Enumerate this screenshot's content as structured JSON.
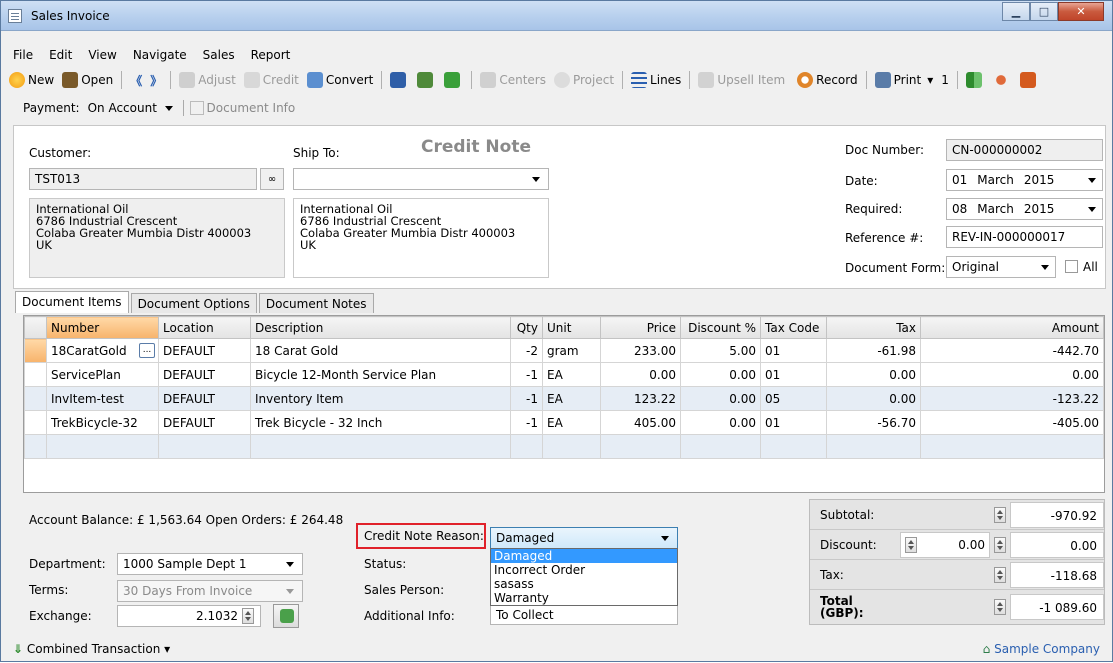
{
  "window": {
    "title": "Sales Invoice"
  },
  "menu": [
    "File",
    "Edit",
    "View",
    "Navigate",
    "Sales",
    "Report"
  ],
  "toolbar": {
    "new": "New",
    "open": "Open",
    "adjust": "Adjust",
    "credit": "Credit",
    "convert": "Convert",
    "centers": "Centers",
    "project": "Project",
    "lines": "Lines",
    "upsell": "Upsell Item",
    "record": "Record",
    "print": "Print",
    "copies": "1"
  },
  "payment": {
    "label": "Payment:",
    "value": "On Account",
    "docinfo": "Document Info"
  },
  "header": {
    "customer_label": "Customer:",
    "customer": "TST013",
    "shipto_label": "Ship To:",
    "heading": "Credit Note",
    "bill_address": [
      "International Oil",
      "6786 Industrial Crescent",
      "Colaba  Greater Mumbia Distr  400003",
      "UK"
    ],
    "ship_address": [
      "International Oil",
      "6786 Industrial Crescent",
      "Colaba  Greater Mumbia Distr  400003",
      "UK"
    ],
    "docnum_label": "Doc Number:",
    "docnum": "CN-000000002",
    "date_label": "Date:",
    "date_day": "01",
    "date_month": "March",
    "date_year": "2015",
    "required_label": "Required:",
    "req_day": "08",
    "req_month": "March",
    "req_year": "2015",
    "ref_label": "Reference #:",
    "ref": "REV-IN-000000017",
    "form_label": "Document Form:",
    "form": "Original",
    "all_label": "All"
  },
  "tabs": [
    "Document Items",
    "Document Options",
    "Document Notes"
  ],
  "grid": {
    "columns": [
      "Number",
      "Location",
      "Description",
      "Qty",
      "Unit",
      "Price",
      "Discount %",
      "Tax Code",
      "Tax",
      "Amount"
    ],
    "rows": [
      [
        "18CaratGold",
        "DEFAULT",
        "18 Carat Gold",
        "-2",
        "gram",
        "233.00",
        "5.00",
        "01",
        "-61.98",
        "-442.70"
      ],
      [
        "ServicePlan",
        "DEFAULT",
        "Bicycle 12-Month Service Plan",
        "-1",
        "EA",
        "0.00",
        "0.00",
        "01",
        "0.00",
        "0.00"
      ],
      [
        "InvItem-test",
        "DEFAULT",
        "Inventory Item",
        "-1",
        "EA",
        "123.22",
        "0.00",
        "05",
        "0.00",
        "-123.22"
      ],
      [
        "TrekBicycle-32",
        "DEFAULT",
        "Trek Bicycle - 32 Inch",
        "-1",
        "EA",
        "405.00",
        "0.00",
        "01",
        "-56.70",
        "-405.00"
      ]
    ]
  },
  "footer": {
    "balance": "Account Balance: £ 1,563.64  Open Orders: £ 264.48",
    "dept_label": "Department:",
    "dept": "1000 Sample Dept 1",
    "terms_label": "Terms:",
    "terms": "30 Days From Invoice",
    "exchange_label": "Exchange:",
    "exchange": "2.1032",
    "reason_label": "Credit Note Reason:",
    "reason": "Damaged",
    "status_label": "Status:",
    "salesperson_label": "Sales Person:",
    "addinfo_label": "Additional Info:",
    "addinfo": "To Collect",
    "reason_options": [
      "Damaged",
      "Incorrect Order",
      "sasass",
      "Warranty"
    ]
  },
  "totals": {
    "subtotal_label": "Subtotal:",
    "subtotal": "-970.92",
    "discount_label": "Discount:",
    "discount_pct": "0.00",
    "discount": "0.00",
    "tax_label": "Tax:",
    "tax": "-118.68",
    "total_label": "Total (GBP):",
    "total": "-1 089.60"
  },
  "status": {
    "combined": "Combined Transaction",
    "company": "Sample Company"
  }
}
